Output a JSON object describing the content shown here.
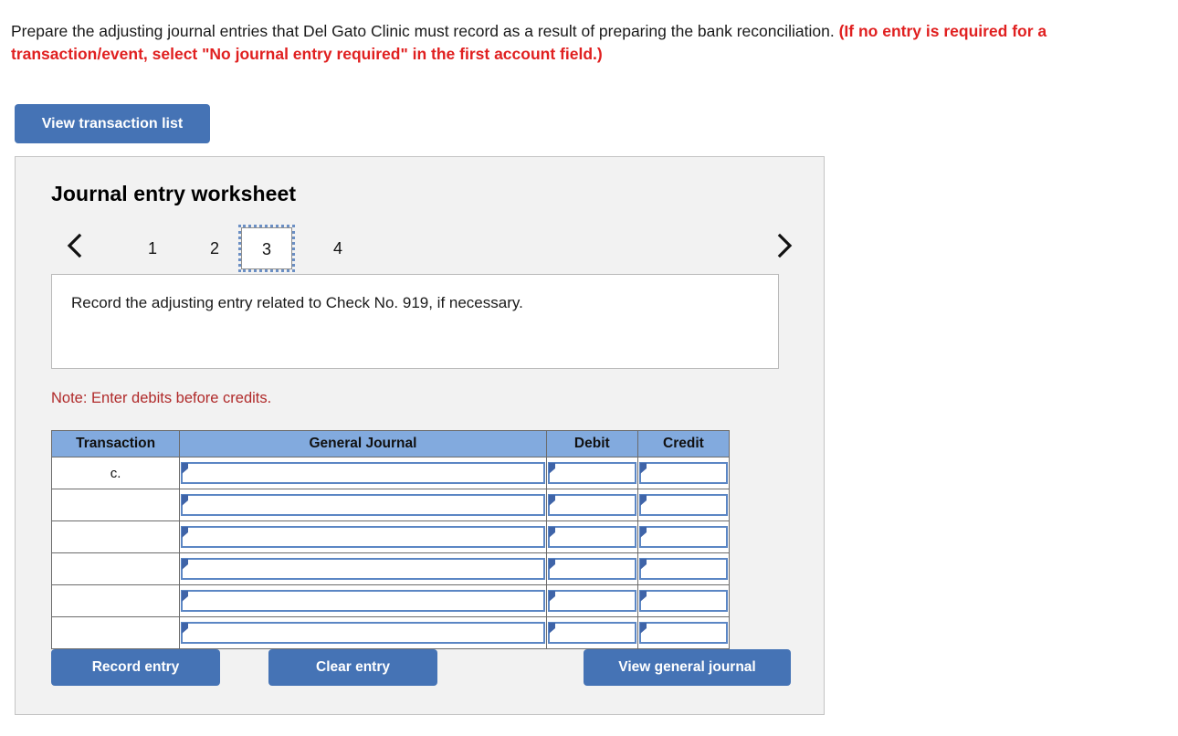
{
  "prompt": {
    "main": "Prepare the adjusting journal entries that Del Gato Clinic must record as a result of preparing the bank reconciliation.",
    "requirement": "(If no entry is required for a transaction/event, select \"No journal entry required\" in the first account field.)"
  },
  "toolbar": {
    "view_transaction_list_label": "View transaction list"
  },
  "worksheet": {
    "title": "Journal entry worksheet",
    "pager": {
      "prev_icon": "chevron-left-icon",
      "next_icon": "chevron-right-icon",
      "tabs": [
        {
          "label": "1",
          "active": false
        },
        {
          "label": "2",
          "active": false
        },
        {
          "label": "3",
          "active": true
        },
        {
          "label": "4",
          "active": false
        }
      ],
      "active_tab": "3"
    },
    "question": "Record the adjusting entry related to Check No. 919, if necessary.",
    "note": "Note: Enter debits before credits.",
    "table": {
      "headers": [
        "Transaction",
        "General Journal",
        "Debit",
        "Credit"
      ],
      "rows": [
        {
          "transaction": "c.",
          "general_journal": "",
          "debit": "",
          "credit": ""
        },
        {
          "transaction": "",
          "general_journal": "",
          "debit": "",
          "credit": ""
        },
        {
          "transaction": "",
          "general_journal": "",
          "debit": "",
          "credit": ""
        },
        {
          "transaction": "",
          "general_journal": "",
          "debit": "",
          "credit": ""
        },
        {
          "transaction": "",
          "general_journal": "",
          "debit": "",
          "credit": ""
        },
        {
          "transaction": "",
          "general_journal": "",
          "debit": "",
          "credit": ""
        }
      ]
    },
    "actions": {
      "record_entry_label": "Record entry",
      "clear_entry_label": "Clear entry",
      "view_general_journal_label": "View general journal"
    }
  },
  "colors": {
    "button_blue": "#4573b5",
    "table_header_blue": "#82aade",
    "field_border_blue": "#5b86c4",
    "note_red": "#b02a2a",
    "requirement_red": "#e02020",
    "panel_background": "#f2f2f2"
  }
}
